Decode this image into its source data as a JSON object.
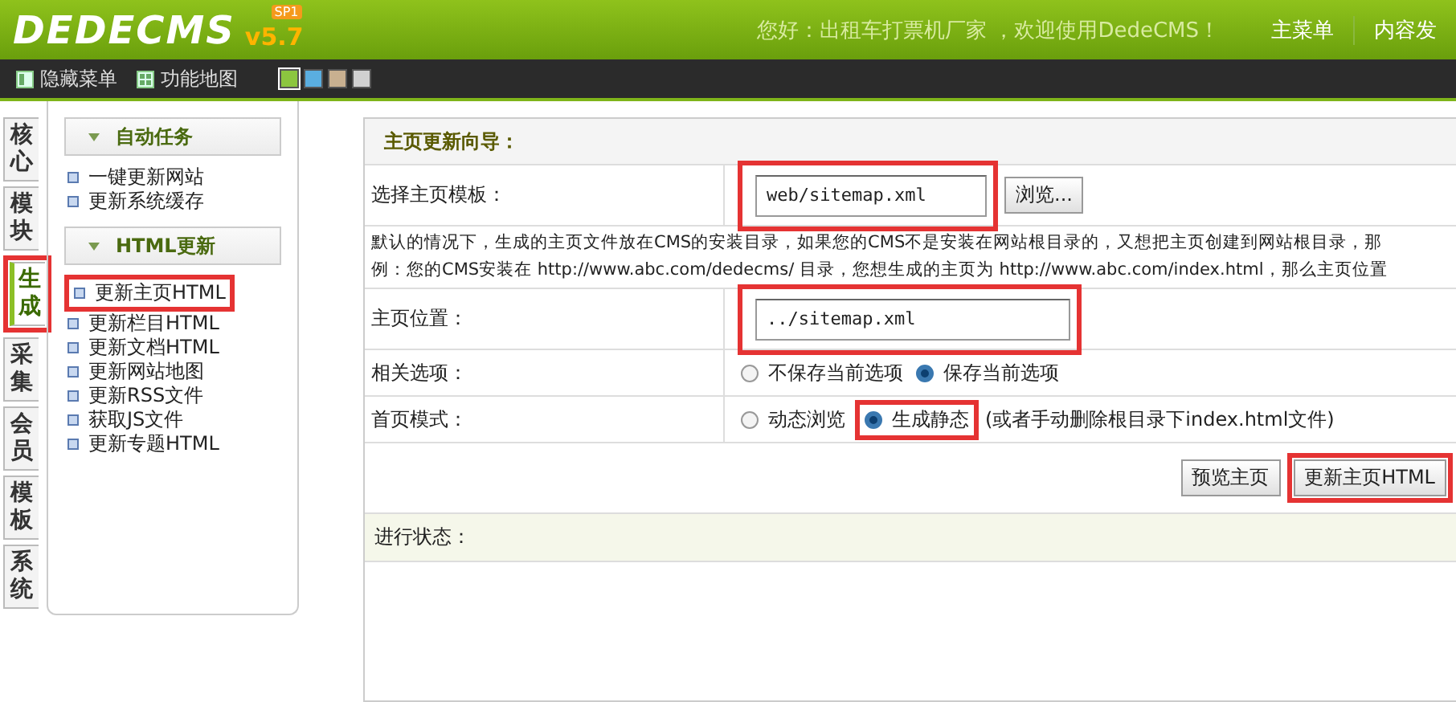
{
  "header": {
    "logo": "DEDECMS",
    "version": "v5.7",
    "badge": "SP1",
    "greeting": "您好：出租车打票机厂家 ，欢迎使用DedeCMS！",
    "nav": [
      "主菜单",
      "内容发"
    ]
  },
  "toolbar": {
    "items": [
      {
        "kind": "hide",
        "label": "隐藏菜单"
      },
      {
        "kind": "map",
        "label": "功能地图"
      }
    ],
    "themes": [
      {
        "color": "#8cc63f",
        "selected": true
      },
      {
        "color": "#5aaee0",
        "selected": false
      },
      {
        "color": "#c8b090",
        "selected": false
      },
      {
        "color": "#d0d0d0",
        "selected": false
      }
    ]
  },
  "side_tabs": [
    {
      "label": "核心",
      "selected": false,
      "highlighted": false
    },
    {
      "label": "模块",
      "selected": false,
      "highlighted": false
    },
    {
      "label": "生成",
      "selected": true,
      "highlighted": true
    },
    {
      "label": "采集",
      "selected": false,
      "highlighted": false
    },
    {
      "label": "会员",
      "selected": false,
      "highlighted": false
    },
    {
      "label": "模板",
      "selected": false,
      "highlighted": false
    },
    {
      "label": "系统",
      "selected": false,
      "highlighted": false
    }
  ],
  "menu": [
    {
      "title": "自动任务",
      "items": [
        {
          "label": "一键更新网站",
          "highlighted": false
        },
        {
          "label": "更新系统缓存",
          "highlighted": false
        }
      ]
    },
    {
      "title": "HTML更新",
      "items": [
        {
          "label": "更新主页HTML",
          "highlighted": true
        },
        {
          "label": "更新栏目HTML",
          "highlighted": false
        },
        {
          "label": "更新文档HTML",
          "highlighted": false
        },
        {
          "label": "更新网站地图",
          "highlighted": false
        },
        {
          "label": "更新RSS文件",
          "highlighted": false
        },
        {
          "label": "获取JS文件",
          "highlighted": false
        },
        {
          "label": "更新专题HTML",
          "highlighted": false
        }
      ]
    }
  ],
  "form": {
    "title": "主页更新向导：",
    "rows": [
      {
        "kind": "file",
        "label": "选择主页模板：",
        "value": "web/sitemap.xml",
        "button": "浏览...",
        "highlighted": true
      },
      {
        "kind": "note",
        "lines": [
          "默认的情况下，生成的主页文件放在CMS的安装目录，如果您的CMS不是安装在网站根目录的，又想把主页创建到网站根目录，那",
          "例：您的CMS安装在 http://www.abc.com/dedecms/ 目录，您想生成的主页为 http://www.abc.com/index.html，那么主页位置"
        ]
      },
      {
        "kind": "text",
        "label": "主页位置：",
        "value": "../sitemap.xml",
        "highlighted": true
      },
      {
        "kind": "radio",
        "label": "相关选项：",
        "options": [
          {
            "label": "不保存当前选项",
            "selected": false,
            "highlighted": false
          },
          {
            "label": "保存当前选项",
            "selected": true,
            "highlighted": false
          }
        ]
      },
      {
        "kind": "radio",
        "label": "首页模式：",
        "options": [
          {
            "label": "动态浏览",
            "selected": false,
            "highlighted": false
          },
          {
            "label": "生成静态",
            "selected": true,
            "highlighted": true
          }
        ],
        "note": "(或者手动删除根目录下index.html文件)"
      }
    ],
    "actions": [
      {
        "label": "预览主页",
        "highlighted": false
      },
      {
        "label": "更新主页HTML",
        "highlighted": true
      }
    ],
    "status_label": "进行状态："
  }
}
